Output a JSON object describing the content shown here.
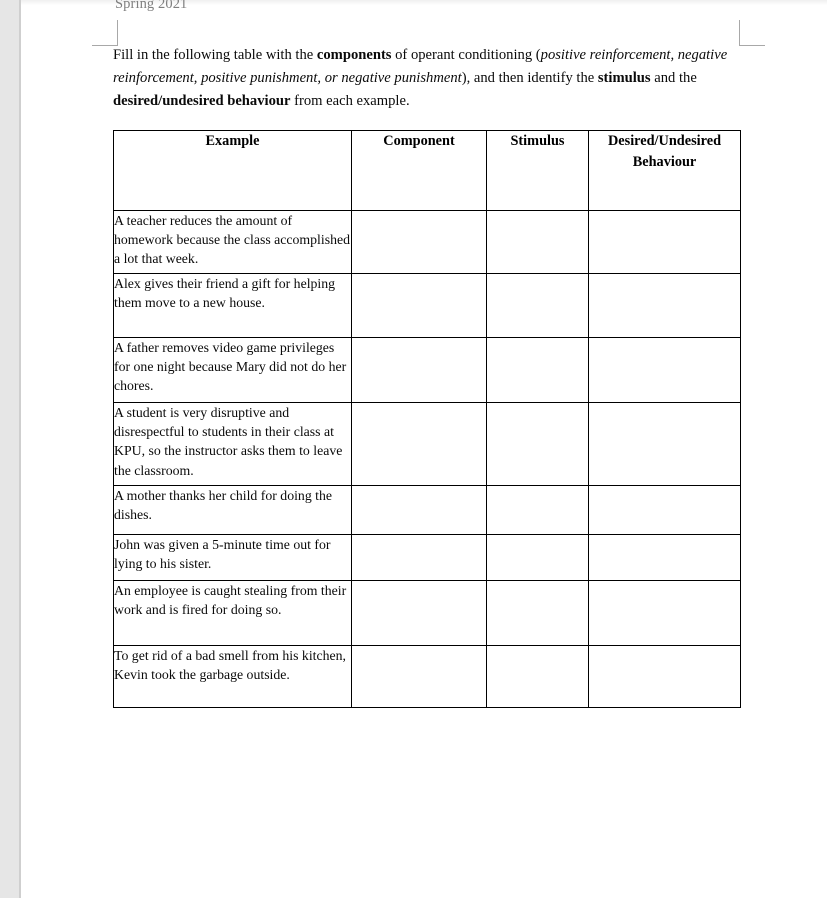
{
  "document": {
    "running_header": "Spring 2021",
    "instructions": {
      "segments": [
        {
          "text": "Fill in the following table with the ",
          "style": "normal"
        },
        {
          "text": "components",
          "style": "bold"
        },
        {
          "text": " of operant conditioning (",
          "style": "normal"
        },
        {
          "text": "positive reinforcement, negative reinforcement, positive punishment, or negative punishment",
          "style": "italic"
        },
        {
          "text": "), and then identify the ",
          "style": "normal"
        },
        {
          "text": "stimulus",
          "style": "bold"
        },
        {
          "text": " and the ",
          "style": "normal"
        },
        {
          "text": "desired/undesired behaviour",
          "style": "bold"
        },
        {
          "text": " from each example.",
          "style": "normal"
        }
      ],
      "plain_text": "Fill in the following table with the components of operant conditioning (positive reinforcement, negative reinforcement, positive punishment, or negative punishment), and then identify the stimulus and the desired/undesired behaviour from each example."
    }
  },
  "table": {
    "headers": [
      "Example",
      "Component",
      "Stimulus",
      "Desired/Undesired Behaviour"
    ],
    "header_behaviour_line1": "Desired/Undesired",
    "header_behaviour_line2": "Behaviour",
    "rows": [
      {
        "example": "A teacher reduces the amount of homework because the class accomplished a lot that week.",
        "component": "",
        "stimulus": "",
        "behaviour": ""
      },
      {
        "example": "Alex gives their friend a gift for helping them move to a new house.",
        "component": "",
        "stimulus": "",
        "behaviour": ""
      },
      {
        "example": "A father removes video game privileges for one night because Mary did not do her chores.",
        "component": "",
        "stimulus": "",
        "behaviour": ""
      },
      {
        "example": "A student is very disruptive and disrespectful to students in their class at KPU, so the instructor asks them to leave the classroom.",
        "component": "",
        "stimulus": "",
        "behaviour": ""
      },
      {
        "example": "A mother thanks her child for doing the dishes.",
        "component": "",
        "stimulus": "",
        "behaviour": ""
      },
      {
        "example": "John was given a 5-minute time out for lying to his sister.",
        "component": "",
        "stimulus": "",
        "behaviour": ""
      },
      {
        "example": "An employee is caught stealing from their work and is fired for doing so.",
        "component": "",
        "stimulus": "",
        "behaviour": ""
      },
      {
        "example": "To get rid of a bad smell from his kitchen, Kevin took the garbage outside.",
        "component": "",
        "stimulus": "",
        "behaviour": ""
      }
    ]
  },
  "colors": {
    "page_background": "#ffffff",
    "gutter": "#e6e6e6",
    "gutter_divider": "#cfcfcf",
    "header_text": "#7f7f7f",
    "body_text": "#0a0a0a",
    "table_border": "#000000",
    "margin_marker": "#a8a8a8"
  }
}
